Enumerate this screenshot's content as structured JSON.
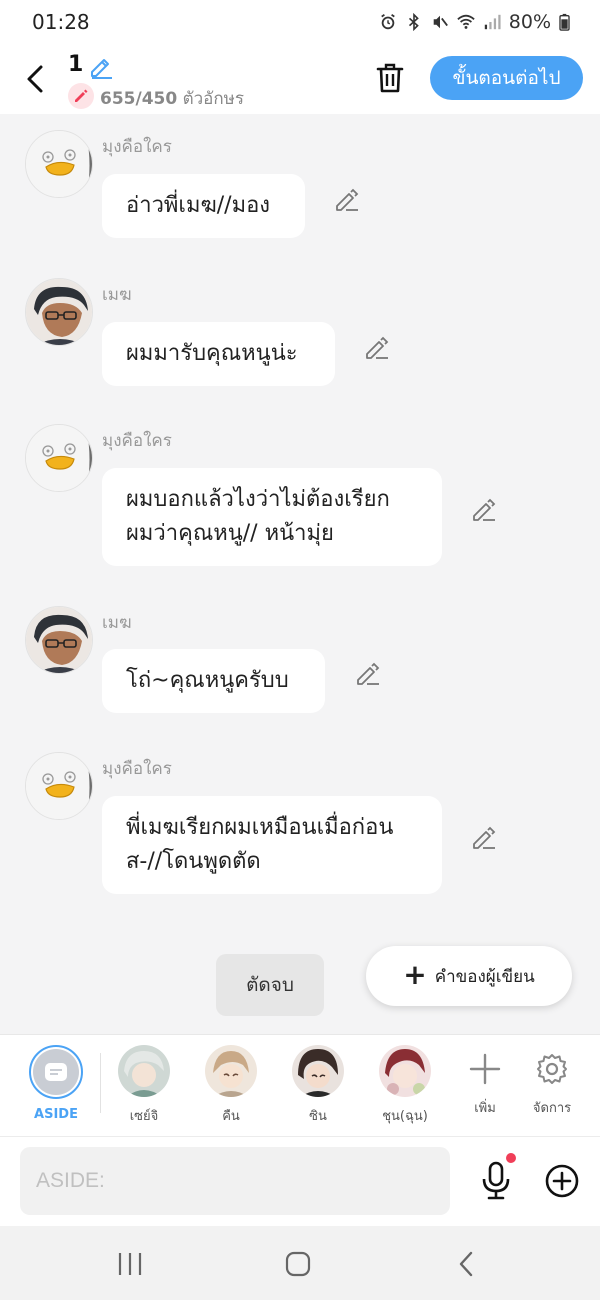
{
  "status": {
    "time": "01:28",
    "battery": "80%"
  },
  "header": {
    "episode": "1",
    "char_count": "655/450",
    "char_unit": "ตัวอักษร",
    "next_label": "ขั้นตอนต่อไป"
  },
  "messages": [
    {
      "speaker": "มุงคือใคร",
      "lines": [
        "อ่าวพี่เมฆ//มอง"
      ]
    },
    {
      "speaker": "เมฆ",
      "lines": [
        "ผมมารับคุณหนูน่ะ"
      ]
    },
    {
      "speaker": "มุงคือใคร",
      "lines": [
        "ผมบอกแล้วไงว่าไม่ต้องเรียก",
        "ผมว่าคุณหนู// หน้ามุ่ย"
      ]
    },
    {
      "speaker": "เมฆ",
      "lines": [
        "โถ่~คุณหนูครับบ"
      ]
    },
    {
      "speaker": "มุงคือใคร",
      "lines": [
        "พี่เมฆเรียกผมเหมือนเมื่อก่อน",
        "ส-//โดนพูดตัด"
      ]
    }
  ],
  "cut_label": "ตัดจบ",
  "fab_label": "คำของผู้เขียน",
  "tray": {
    "aside_label": "ASIDE",
    "characters": [
      {
        "name": "เซย์จิ"
      },
      {
        "name": "คืน"
      },
      {
        "name": "ซิน"
      },
      {
        "name": "ชุน(ฉุน)"
      }
    ],
    "add_label": "เพิ่ม",
    "manage_label": "จัดการ"
  },
  "input": {
    "placeholder": "ASIDE:"
  },
  "colors": {
    "accent": "#4ba3f5",
    "badge": "#f03e58"
  }
}
